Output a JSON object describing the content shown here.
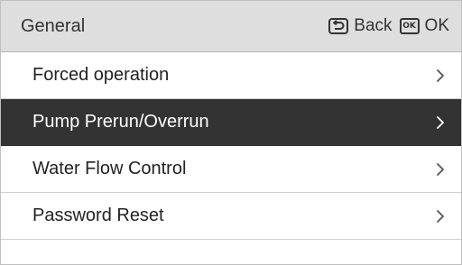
{
  "header": {
    "title": "General",
    "back_label": "Back",
    "ok_icon_text": "OK",
    "ok_label": "OK"
  },
  "menu": {
    "items": [
      {
        "label": "Forced operation",
        "selected": false
      },
      {
        "label": "Pump Prerun/Overrun",
        "selected": true
      },
      {
        "label": "Water Flow Control",
        "selected": false
      },
      {
        "label": "Password Reset",
        "selected": false
      }
    ]
  },
  "icons": {
    "back": "back-arrow-icon",
    "ok": "ok-key-icon",
    "item_arrow": "chevron-right-icon"
  },
  "colors": {
    "header_bg": "#dedede",
    "selected_bg": "#333333",
    "selected_text": "#ffffff",
    "text": "#222222"
  }
}
